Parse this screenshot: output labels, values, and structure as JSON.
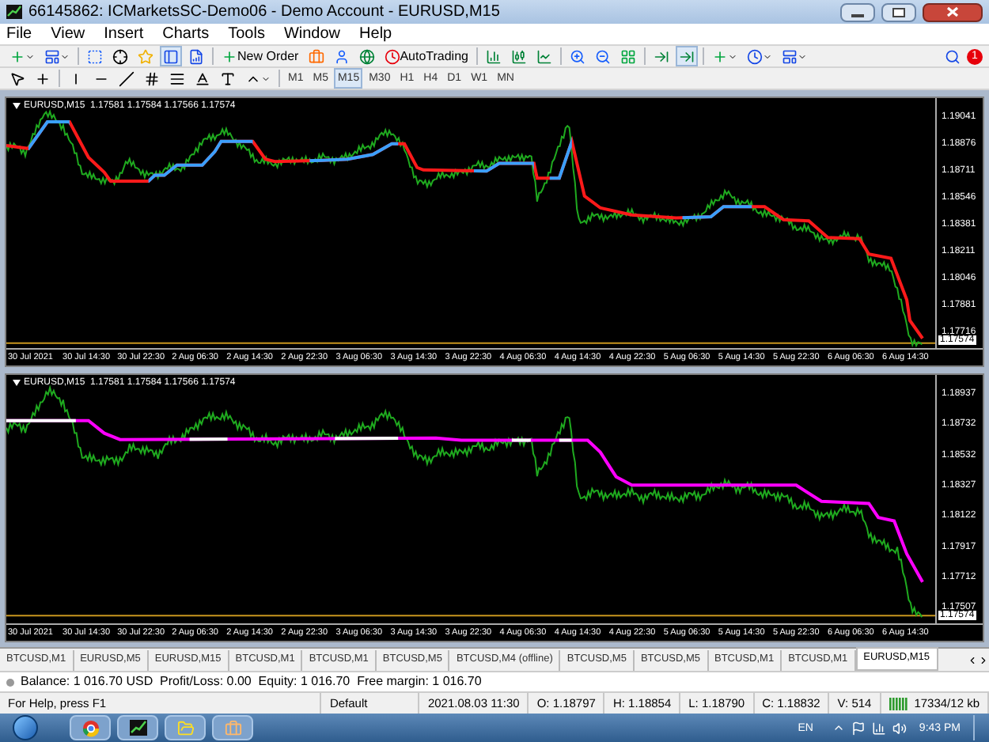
{
  "window": {
    "title": "66145862: ICMarketsSC-Demo06 - Demo Account - EURUSD,M15"
  },
  "menu": [
    "File",
    "View",
    "Insert",
    "Charts",
    "Tools",
    "Window",
    "Help"
  ],
  "toolbar": {
    "new_order": "New Order",
    "auto_trading": "AutoTrading",
    "notification_count": "1"
  },
  "timeframes": [
    {
      "label": "M1",
      "selected": false
    },
    {
      "label": "M5",
      "selected": false
    },
    {
      "label": "M15",
      "selected": true
    },
    {
      "label": "M30",
      "selected": false
    },
    {
      "label": "H1",
      "selected": false
    },
    {
      "label": "H4",
      "selected": false
    },
    {
      "label": "D1",
      "selected": false
    },
    {
      "label": "W1",
      "selected": false
    },
    {
      "label": "MN",
      "selected": false
    }
  ],
  "charts": [
    {
      "header": "EURUSD,M15  1.17581 1.17584 1.17566 1.17574",
      "price_labels": [
        "1.19041",
        "1.18876",
        "1.18711",
        "1.18546",
        "1.18381",
        "1.18211",
        "1.18046",
        "1.17881",
        "1.17716"
      ],
      "current_price": "1.17574",
      "time_labels": [
        "30 Jul 2021",
        "30 Jul 14:30",
        "30 Jul 22:30",
        "2 Aug 06:30",
        "2 Aug 14:30",
        "2 Aug 22:30",
        "3 Aug 06:30",
        "3 Aug 14:30",
        "3 Aug 22:30",
        "4 Aug 06:30",
        "4 Aug 14:30",
        "4 Aug 22:30",
        "5 Aug 06:30",
        "5 Aug 14:30",
        "5 Aug 22:30",
        "6 Aug 06:30",
        "6 Aug 14:30"
      ]
    },
    {
      "header": "EURUSD,M15  1.17581 1.17584 1.17566 1.17574",
      "price_labels": [
        "1.18937",
        "1.18732",
        "1.18532",
        "1.18327",
        "1.18122",
        "1.17917",
        "1.17712",
        "1.17507"
      ],
      "current_price": "1.17574",
      "time_labels": [
        "30 Jul 2021",
        "30 Jul 14:30",
        "30 Jul 22:30",
        "2 Aug 06:30",
        "2 Aug 14:30",
        "2 Aug 22:30",
        "3 Aug 06:30",
        "3 Aug 14:30",
        "3 Aug 22:30",
        "4 Aug 06:30",
        "4 Aug 14:30",
        "4 Aug 22:30",
        "5 Aug 06:30",
        "5 Aug 14:30",
        "5 Aug 22:30",
        "6 Aug 06:30",
        "6 Aug 14:30"
      ]
    }
  ],
  "chart_tabs": [
    {
      "label": "BTCUSD,M1",
      "selected": false
    },
    {
      "label": "EURUSD,M5",
      "selected": false
    },
    {
      "label": "EURUSD,M15",
      "selected": false
    },
    {
      "label": "BTCUSD,M1",
      "selected": false
    },
    {
      "label": "BTCUSD,M1",
      "selected": false
    },
    {
      "label": "BTCUSD,M5",
      "selected": false
    },
    {
      "label": "BTCUSD,M4 (offline)",
      "selected": false
    },
    {
      "label": "BTCUSD,M5",
      "selected": false
    },
    {
      "label": "BTCUSD,M5",
      "selected": false
    },
    {
      "label": "BTCUSD,M1",
      "selected": false
    },
    {
      "label": "BTCUSD,M1",
      "selected": false
    },
    {
      "label": "EURUSD,M15",
      "selected": true
    }
  ],
  "account_line": "Balance: 1 016.70 USD  Profit/Loss: 0.00  Equity: 1 016.70  Free margin: 1 016.70",
  "status_bar": [
    "For Help, press F1",
    "Default",
    "2021.08.03 11:30",
    "O: 1.18797",
    "H: 1.18854",
    "L: 1.18790",
    "C: 1.18832",
    "V: 514",
    "17334/12 kb"
  ],
  "taskbar": {
    "language": "EN",
    "clock": "9:43 PM"
  }
}
